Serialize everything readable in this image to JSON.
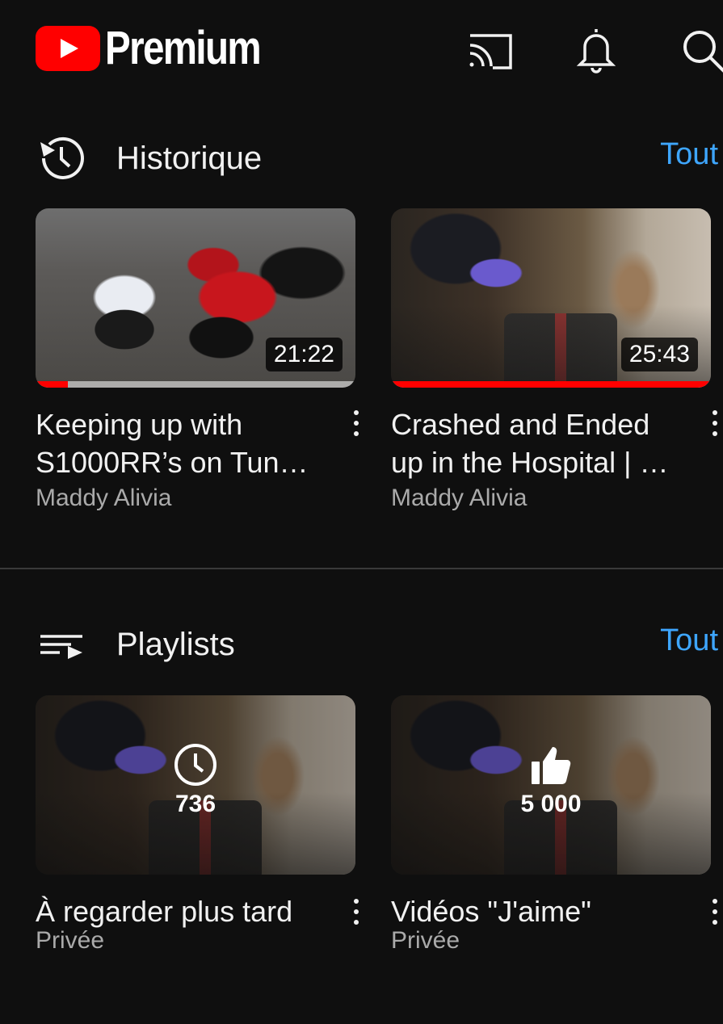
{
  "header": {
    "logo_text": "Premium",
    "icons": [
      "cast-icon",
      "bell-icon",
      "search-icon"
    ]
  },
  "history": {
    "title": "Historique",
    "all_label": "Tout",
    "icon": "history-icon",
    "videos": [
      {
        "title": "Keeping up with S1000RR’s on Tun…",
        "channel": "Maddy Alivia",
        "duration": "21:22",
        "watched_fraction": 0.1
      },
      {
        "title": "Crashed and Ended up in the Hospital | …",
        "channel": "Maddy Alivia",
        "duration": "25:43",
        "watched_fraction": 1.0
      }
    ]
  },
  "playlists": {
    "title": "Playlists",
    "all_label": "Tout",
    "icon": "playlist-icon",
    "items": [
      {
        "title": "À regarder plus tard",
        "privacy": "Privée",
        "count": "736",
        "icon": "clock-icon"
      },
      {
        "title": "Vidéos \"J'aime\"",
        "privacy": "Privée",
        "count": "5 000",
        "icon": "thumbs-up-icon"
      }
    ]
  },
  "colors": {
    "accent_link": "#3ea6ff",
    "brand_red": "#ff0000",
    "background": "#0f0f0f"
  }
}
